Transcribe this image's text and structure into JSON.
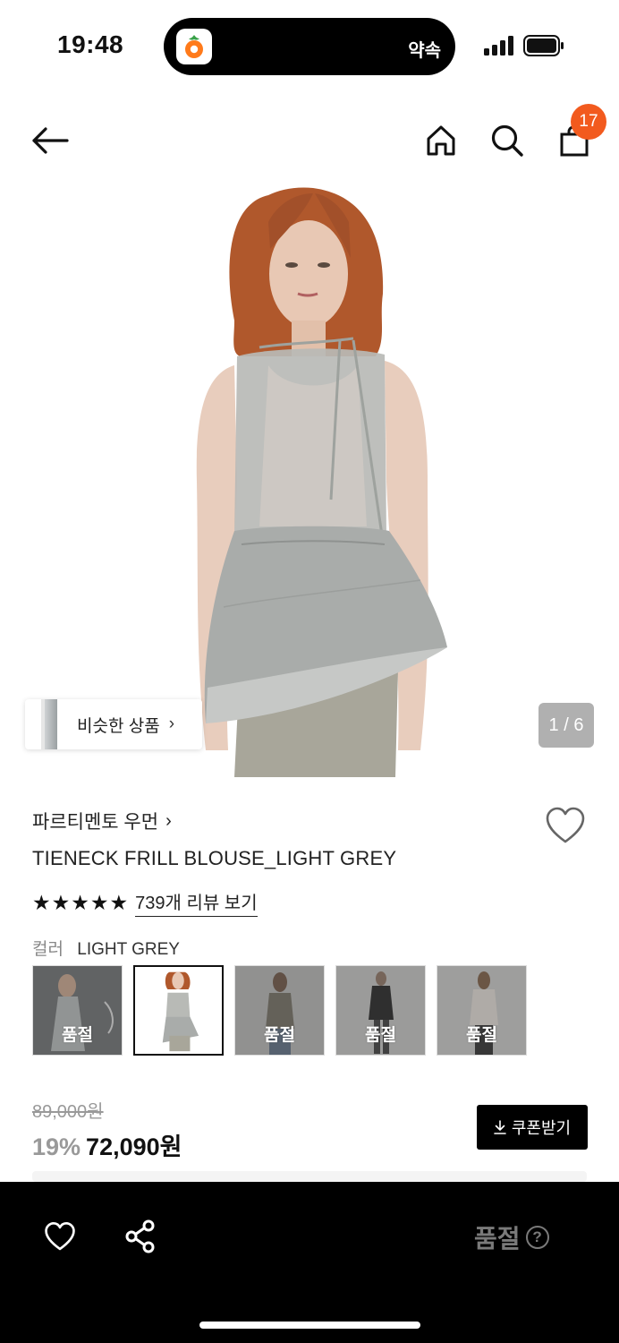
{
  "status_bar": {
    "time": "19:48",
    "island_label": "약속",
    "island_app_icon": "carrot-app-icon"
  },
  "nav": {
    "back_icon": "arrow-left-icon",
    "home_icon": "home-icon",
    "search_icon": "search-icon",
    "cart_icon": "shopping-bag-icon",
    "cart_count": "17",
    "badge_color": "#f25a1e"
  },
  "hero": {
    "similar_label": "비슷한 상품",
    "similar_chevron": "›",
    "page_indicator": "1 / 6"
  },
  "product": {
    "brand": "파르티멘토 우먼",
    "brand_chevron": "›",
    "name": "TIENECK FRILL BLOUSE_LIGHT GREY",
    "stars": [
      "★",
      "★",
      "★",
      "★",
      "★"
    ],
    "rating": 5,
    "review_link": "739개 리뷰 보기",
    "color_label": "컬러",
    "color_value": "LIGHT GREY",
    "options": [
      {
        "soldout": true,
        "soldout_label": "품절"
      },
      {
        "soldout": false,
        "soldout_label": ""
      },
      {
        "soldout": true,
        "soldout_label": "품절"
      },
      {
        "soldout": true,
        "soldout_label": "품절"
      },
      {
        "soldout": true,
        "soldout_label": "품절"
      }
    ],
    "original_price": "89,000원",
    "discount": "19%",
    "sale_price": "72,090원",
    "coupon_button": "쿠폰받기",
    "coupon_icon": "download-icon"
  },
  "bottom_bar": {
    "wish_icon": "heart-icon",
    "share_icon": "share-icon",
    "soldout_label": "품절",
    "help_mark": "?"
  }
}
